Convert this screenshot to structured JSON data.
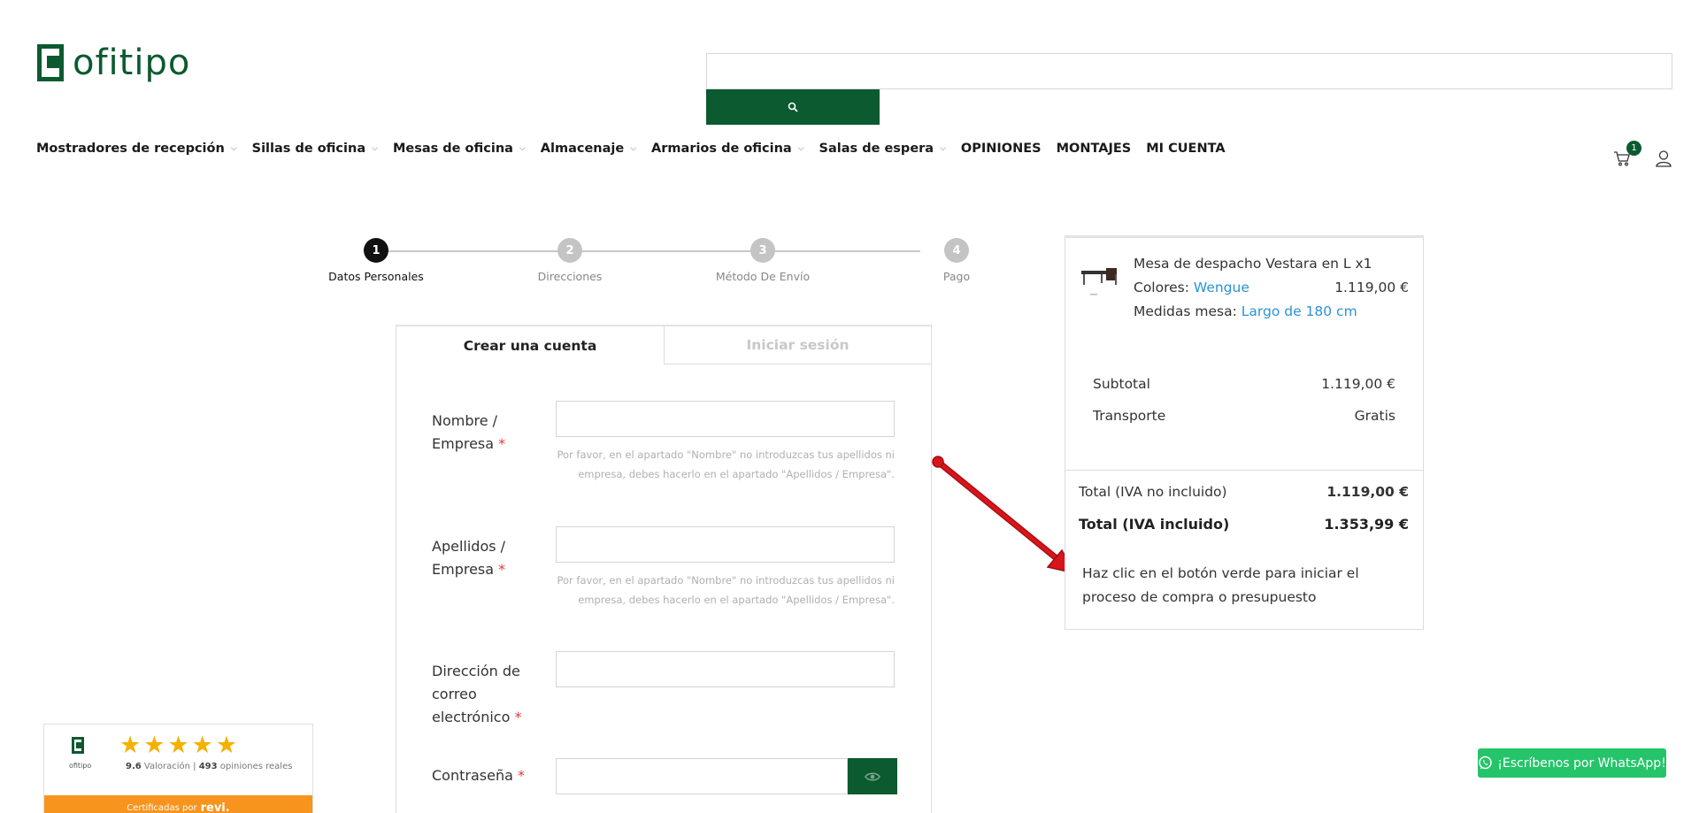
{
  "header": {
    "logo_text": "ofitipo",
    "search": {
      "placeholder": ""
    },
    "nav": [
      {
        "label": "Mostradores de recepción",
        "dropdown": true
      },
      {
        "label": "Sillas de oficina",
        "dropdown": true
      },
      {
        "label": "Mesas de oficina",
        "dropdown": true
      },
      {
        "label": "Almacenaje",
        "dropdown": true
      },
      {
        "label": "Armarios de oficina",
        "dropdown": true
      },
      {
        "label": "Salas de espera",
        "dropdown": true
      },
      {
        "label": "OPINIONES",
        "dropdown": false
      },
      {
        "label": "MONTAJES",
        "dropdown": false
      },
      {
        "label": "MI CUENTA",
        "dropdown": false
      }
    ],
    "cart_count": "1",
    "icons": [
      "search-icon",
      "cart-icon",
      "user-icon",
      "chevron-down-icon"
    ]
  },
  "steps": [
    {
      "number": "1",
      "label": "Datos Personales",
      "active": true
    },
    {
      "number": "2",
      "label": "Direcciones",
      "active": false
    },
    {
      "number": "3",
      "label": "Método De Envío",
      "active": false
    },
    {
      "number": "4",
      "label": "Pago",
      "active": false
    }
  ],
  "form": {
    "tabs": [
      {
        "label": "Crear una cuenta",
        "active": true
      },
      {
        "label": "Iniciar sesión",
        "active": false
      }
    ],
    "fields": [
      {
        "label": "Nombre / Empresa",
        "required": "*",
        "value": "",
        "hint": "Por favor, en el apartado \"Nombre\" no introduzcas tus apellidos ni empresa, debes hacerlo en el apartado \"Apellidos / Empresa\"."
      },
      {
        "label": "Apellidos / Empresa",
        "required": "*",
        "value": "",
        "hint": "Por favor, en el apartado \"Nombre\" no introduzcas tus apellidos ni empresa, debes hacerlo en el apartado \"Apellidos / Empresa\"."
      },
      {
        "label": "Dirección de correo electrónico",
        "required": "*",
        "value": ""
      },
      {
        "label": "Contraseña",
        "required": "*",
        "value": ""
      }
    ]
  },
  "summary": {
    "product": {
      "name": "Mesa de despacho Vestara en L x1",
      "color_label": "Colores:",
      "color_value": "Wengue",
      "size_label": "Medidas mesa:",
      "size_value": "Largo de 180 cm",
      "price": "1.119,00 €"
    },
    "subtotal": {
      "label": "Subtotal",
      "value": "1.119,00 €"
    },
    "shipping": {
      "label": "Transporte",
      "value": "Gratis"
    },
    "total_no_vat": {
      "label": "Total (IVA no incluido)",
      "value": "1.119,00 €"
    },
    "total_vat": {
      "label": "Total (IVA incluido)",
      "value": "1.353,99 €"
    },
    "note": "Haz clic en el botón verde para iniciar el proceso de compra o presupuesto"
  },
  "reviews_widget": {
    "logo_text": "ofitipo",
    "stars": 5,
    "rating": "9.6",
    "rating_label": "Valoración |",
    "count": "493",
    "count_label": "opiniones reales",
    "certified_text": "Certificadas por",
    "brand": "revi."
  },
  "whatsapp": {
    "label": "¡Escríbenos por WhatsApp!"
  },
  "colors": {
    "brand_green": "#0b5a30",
    "link_blue": "#2a94d6",
    "required_red": "#e53935",
    "whatsapp_green": "#25c46a",
    "revi_orange": "#f7941d",
    "arrow_red": "#d9141b"
  }
}
